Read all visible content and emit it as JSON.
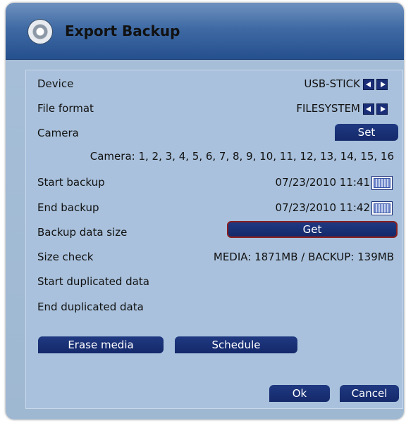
{
  "window": {
    "title": "Export Backup",
    "icon": "disc-icon"
  },
  "rows": {
    "device": {
      "label": "Device",
      "value": "USB-STICK"
    },
    "file_format": {
      "label": "File format",
      "value": "FILESYSTEM"
    },
    "camera": {
      "label": "Camera",
      "button": "Set",
      "list": "Camera: 1, 2, 3, 4, 5, 6, 7, 8, 9, 10, 11, 12, 13, 14, 15, 16"
    },
    "start_backup": {
      "label": "Start backup",
      "value": "07/23/2010 11:41"
    },
    "end_backup": {
      "label": "End backup",
      "value": "07/23/2010 11:42"
    },
    "backup_data_size": {
      "label": "Backup data size",
      "button": "Get"
    },
    "size_check": {
      "label": "Size check",
      "value": "MEDIA: 1871MB / BACKUP: 139MB"
    },
    "start_duplicated": {
      "label": "Start duplicated data"
    },
    "end_duplicated": {
      "label": "End duplicated data"
    }
  },
  "buttons": {
    "erase_media": "Erase media",
    "schedule": "Schedule",
    "ok": "Ok",
    "cancel": "Cancel"
  },
  "colors": {
    "button": "#1a2e78",
    "title_bar": "#3f6aa4",
    "panel": "#a9c1dc",
    "selected_border": "#8a1f1f"
  }
}
